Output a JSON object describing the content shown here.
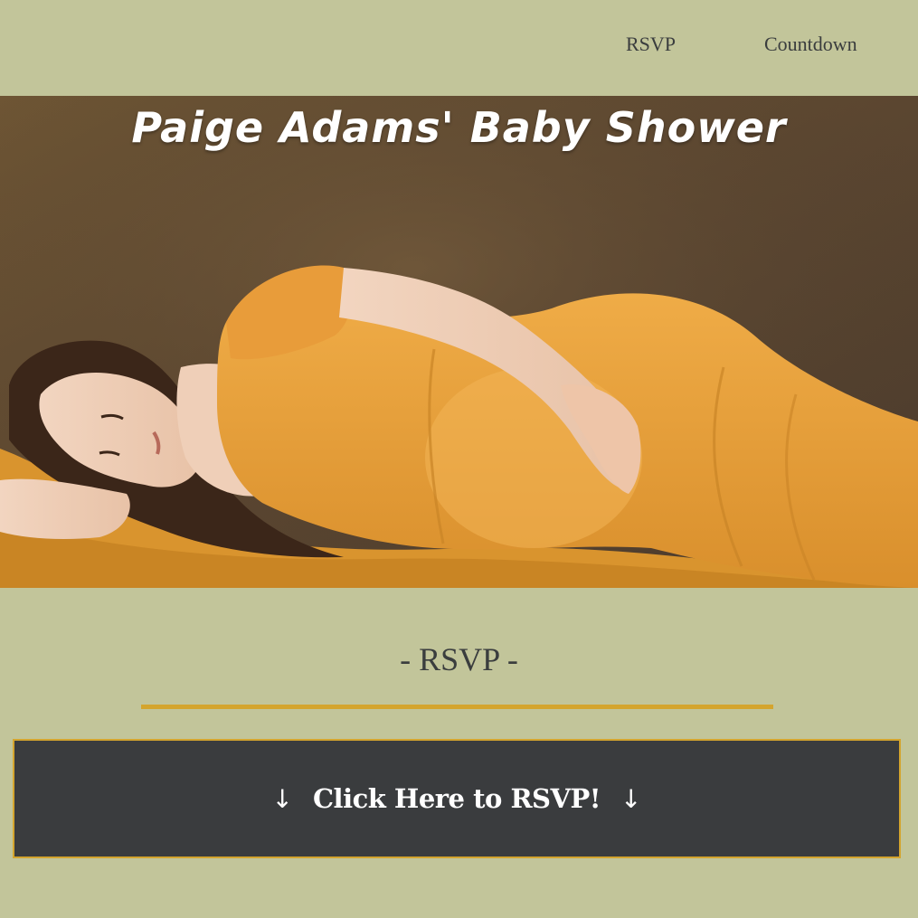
{
  "nav": {
    "links": [
      {
        "label": "RSVP"
      },
      {
        "label": "Countdown"
      }
    ]
  },
  "hero": {
    "title": "Paige Adams' Baby Shower"
  },
  "rsvp_section": {
    "heading": "- RSVP -",
    "button": {
      "arrow_left": "↓",
      "label": "Click Here to RSVP!",
      "arrow_right": "↓"
    }
  },
  "colors": {
    "page_background": "#c2c59a",
    "accent": "#d4a52e",
    "button_background": "#3a3c3e",
    "text": "#3a3d3e"
  }
}
